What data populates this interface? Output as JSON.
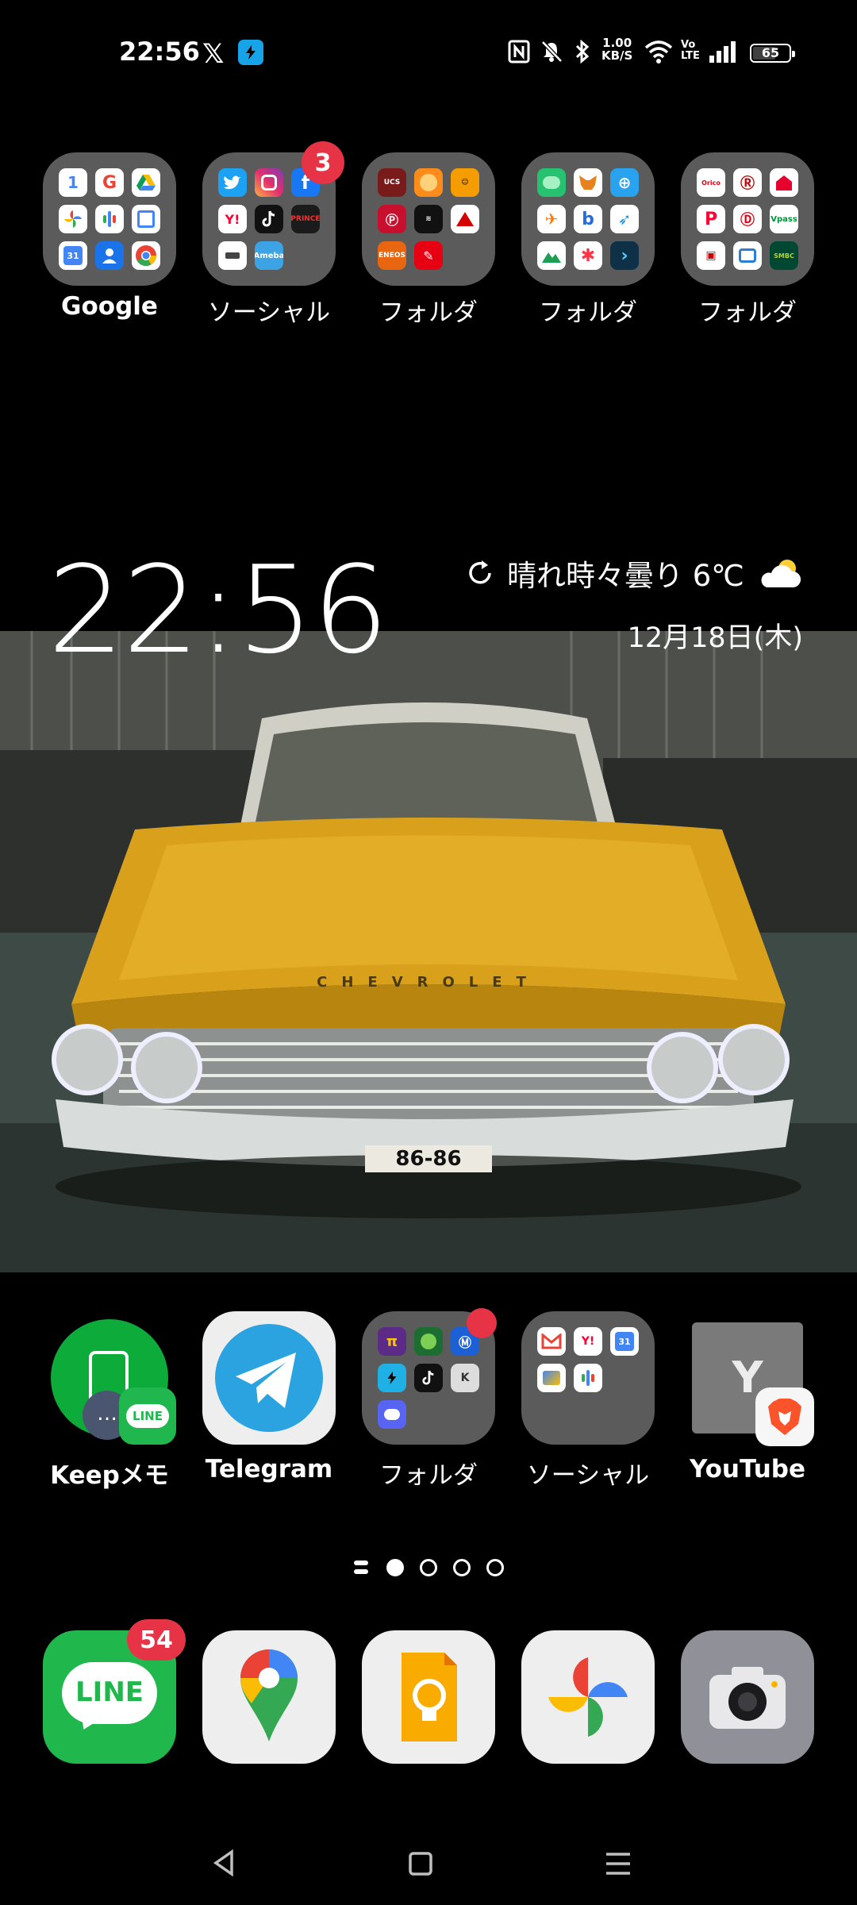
{
  "status_bar": {
    "time": "22:56",
    "net_speed_value": "1.00",
    "net_speed_unit": "KB/S",
    "volte_top": "Vo",
    "volte_bottom": "LTE",
    "battery": "65",
    "icons": [
      "x-icon",
      "bolt-app-icon",
      "nfc-icon",
      "mute-icon",
      "bluetooth-icon",
      "wifi-icon",
      "signal-icon",
      "battery-icon"
    ]
  },
  "top_folders": [
    {
      "label": "Google",
      "badge": ""
    },
    {
      "label": "ソーシャル",
      "badge": "3"
    },
    {
      "label": "フォルダ",
      "badge": ""
    },
    {
      "label": "フォルダ",
      "badge": ""
    },
    {
      "label": "フォルダ",
      "badge": ""
    }
  ],
  "widget": {
    "clock": "22:56",
    "weather": "晴れ時々曇り 6℃",
    "date": "12月18日(木)"
  },
  "wallpaper": {
    "plate": "86-86",
    "emblem": "CHEVROLET"
  },
  "row_apps": [
    {
      "label": "Keepメモ",
      "sub_badge": "LINE"
    },
    {
      "label": "Telegram"
    },
    {
      "label": "フォルダ"
    },
    {
      "label": "ソーシャル"
    },
    {
      "label": "YouTube",
      "letter": "Y"
    }
  ],
  "dock": {
    "line_text": "LINE",
    "line_badge": "54"
  },
  "page_indicator": {
    "pages": 4,
    "active": 1
  }
}
